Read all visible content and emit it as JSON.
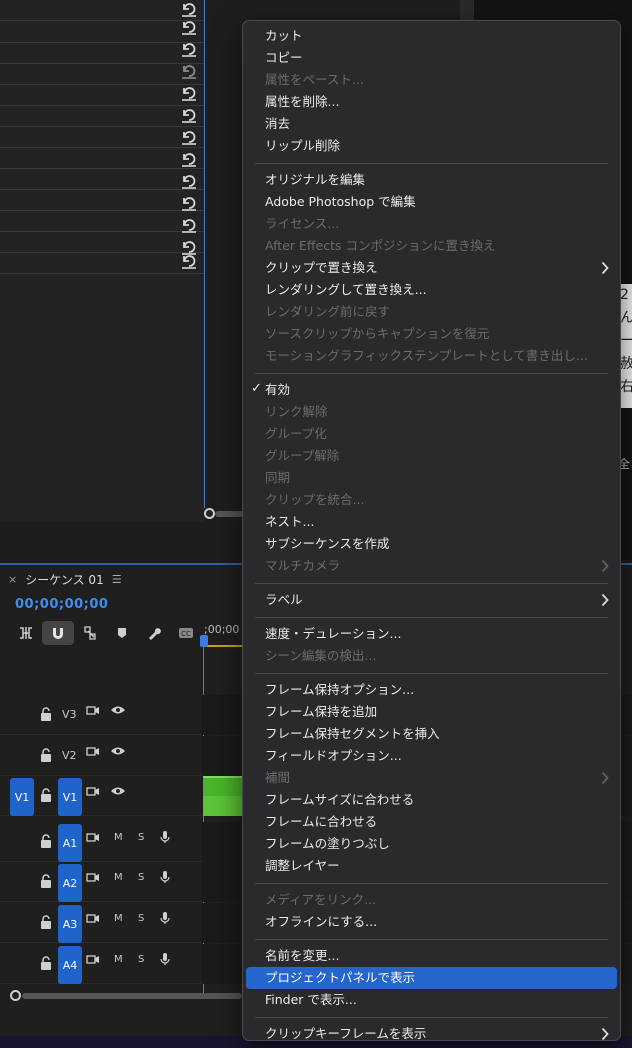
{
  "timeline": {
    "sequence_tab": "シーケンス 01",
    "close_glyph": "×",
    "menu_glyph": "☰",
    "timecode": "00;00;00;00",
    "ruler_label": ";00;00",
    "tracks": [
      {
        "name": "V3",
        "type": "video"
      },
      {
        "name": "V2",
        "type": "video"
      },
      {
        "name": "V1",
        "type": "video",
        "source": "V1"
      },
      {
        "name": "A1",
        "type": "audio"
      },
      {
        "name": "A2",
        "type": "audio"
      },
      {
        "name": "A3",
        "type": "audio"
      },
      {
        "name": "A4",
        "type": "audio"
      }
    ],
    "mute_label": "M",
    "solo_label": "S",
    "accent_color": "#1f64c9",
    "clip_color": "#49b52b"
  },
  "monitor_fragment": [
    "2",
    "ん",
    "ー",
    "赦",
    "右"
  ],
  "right_control_label": "全",
  "context_menu": {
    "groups": [
      [
        {
          "label": "カット",
          "enabled": true
        },
        {
          "label": "コピー",
          "enabled": true
        },
        {
          "label": "属性をペースト...",
          "enabled": false
        },
        {
          "label": "属性を削除...",
          "enabled": true
        },
        {
          "label": "消去",
          "enabled": true
        },
        {
          "label": "リップル削除",
          "enabled": true
        }
      ],
      [
        {
          "label": "オリジナルを編集",
          "enabled": true
        },
        {
          "label": "Adobe Photoshop で編集",
          "enabled": true
        },
        {
          "label": "ライセンス...",
          "enabled": false
        },
        {
          "label": "After Effects コンポジションに置き換え",
          "enabled": false
        },
        {
          "label": "クリップで置き換え",
          "enabled": true,
          "submenu": true
        },
        {
          "label": "レンダリングして置き換え...",
          "enabled": true
        },
        {
          "label": "レンダリング前に戻す",
          "enabled": false
        },
        {
          "label": "ソースクリップからキャプションを復元",
          "enabled": false
        },
        {
          "label": "モーショングラフィックステンプレートとして書き出し...",
          "enabled": false
        }
      ],
      [
        {
          "label": "有効",
          "enabled": true,
          "checked": true
        },
        {
          "label": "リンク解除",
          "enabled": false
        },
        {
          "label": "グループ化",
          "enabled": false
        },
        {
          "label": "グループ解除",
          "enabled": false
        },
        {
          "label": "同期",
          "enabled": false
        },
        {
          "label": "クリップを統合...",
          "enabled": false
        },
        {
          "label": "ネスト...",
          "enabled": true
        },
        {
          "label": "サブシーケンスを作成",
          "enabled": true
        },
        {
          "label": "マルチカメラ",
          "enabled": false,
          "submenu": true
        }
      ],
      [
        {
          "label": "ラベル",
          "enabled": true,
          "submenu": true
        }
      ],
      [
        {
          "label": "速度・デュレーション...",
          "enabled": true
        },
        {
          "label": "シーン編集の検出...",
          "enabled": false
        }
      ],
      [
        {
          "label": "フレーム保持オプション...",
          "enabled": true
        },
        {
          "label": "フレーム保持を追加",
          "enabled": true
        },
        {
          "label": "フレーム保持セグメントを挿入",
          "enabled": true
        },
        {
          "label": "フィールドオプション...",
          "enabled": true
        },
        {
          "label": "補間",
          "enabled": false,
          "submenu": true
        },
        {
          "label": "フレームサイズに合わせる",
          "enabled": true
        },
        {
          "label": "フレームに合わせる",
          "enabled": true
        },
        {
          "label": "フレームの塗りつぶし",
          "enabled": true
        },
        {
          "label": "調整レイヤー",
          "enabled": true
        }
      ],
      [
        {
          "label": "メディアをリンク...",
          "enabled": false
        },
        {
          "label": "オフラインにする...",
          "enabled": true
        }
      ],
      [
        {
          "label": "名前を変更...",
          "enabled": true
        },
        {
          "label": "プロジェクトパネルで表示",
          "enabled": true,
          "highlighted": true
        },
        {
          "label": "Finder で表示...",
          "enabled": true
        }
      ],
      [
        {
          "label": "クリップキーフレームを表示",
          "enabled": true,
          "submenu": true
        }
      ]
    ],
    "check_glyph": "✓",
    "highlight_color": "#2566cc"
  }
}
